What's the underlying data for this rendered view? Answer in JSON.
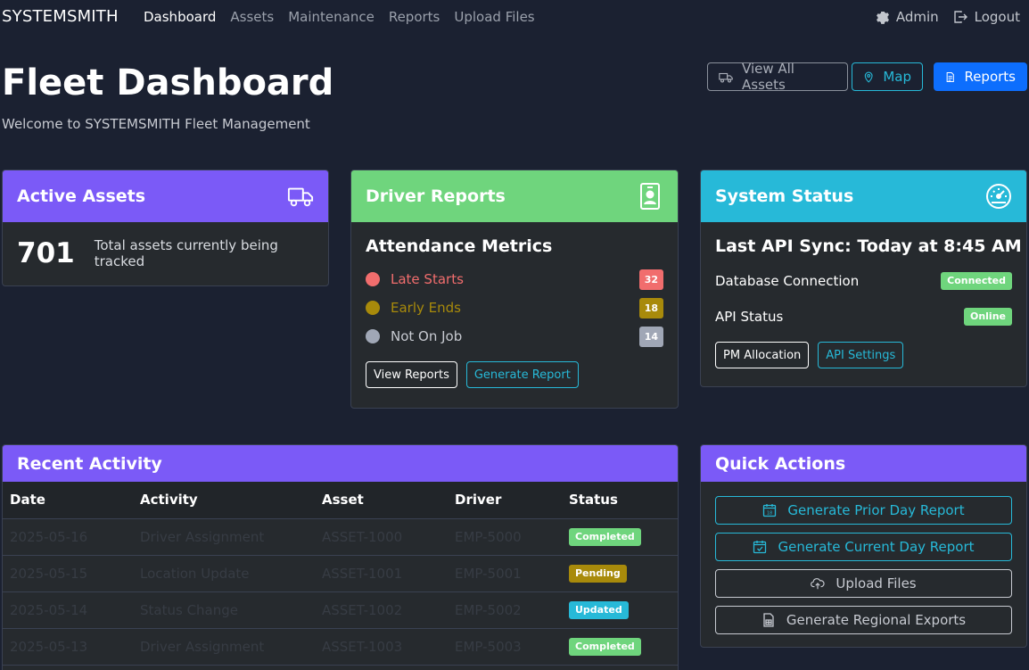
{
  "nav": {
    "brand": "SYSTEMSMITH",
    "links": [
      "Dashboard",
      "Assets",
      "Maintenance",
      "Reports",
      "Upload Files"
    ],
    "admin": "Admin",
    "logout": "Logout"
  },
  "header": {
    "title": "Fleet Dashboard",
    "subtitle": "Welcome to SYSTEMSMITH Fleet Management",
    "view_all_assets": "View All Assets",
    "map": "Map",
    "reports": "Reports"
  },
  "active_assets": {
    "title": "Active Assets",
    "count": "701",
    "description": "Total assets currently being tracked"
  },
  "driver_reports": {
    "title": "Driver Reports",
    "subtitle": "Attendance Metrics",
    "metrics": [
      {
        "label": "Late Starts",
        "count": "32",
        "color": "#f16d6d"
      },
      {
        "label": "Early Ends",
        "count": "18",
        "color": "#a88a0b"
      },
      {
        "label": "Not On Job",
        "count": "14",
        "color": "#a0a7b6"
      }
    ],
    "view_reports": "View Reports",
    "generate_report": "Generate Report"
  },
  "system_status": {
    "title": "System Status",
    "last_sync": "Last API Sync: Today at 8:45 AM",
    "db_label": "Database Connection",
    "db_status": "Connected",
    "api_label": "API Status",
    "api_status": "Online",
    "pm_allocation": "PM Allocation",
    "api_settings": "API Settings"
  },
  "recent_activity": {
    "title": "Recent Activity",
    "columns": [
      "Date",
      "Activity",
      "Asset",
      "Driver",
      "Status"
    ],
    "rows": [
      {
        "date": "2025-05-16",
        "activity": "Driver Assignment",
        "asset": "ASSET-1000",
        "driver": "EMP-5000",
        "status": "Completed",
        "status_color": "#6fd57d"
      },
      {
        "date": "2025-05-15",
        "activity": "Location Update",
        "asset": "ASSET-1001",
        "driver": "EMP-5001",
        "status": "Pending",
        "status_color": "#a88a0b"
      },
      {
        "date": "2025-05-14",
        "activity": "Status Change",
        "asset": "ASSET-1002",
        "driver": "EMP-5002",
        "status": "Updated",
        "status_color": "#27b9d8"
      },
      {
        "date": "2025-05-13",
        "activity": "Driver Assignment",
        "asset": "ASSET-1003",
        "driver": "EMP-5003",
        "status": "Completed",
        "status_color": "#6fd57d"
      }
    ]
  },
  "quick_actions": {
    "title": "Quick Actions",
    "buttons": [
      {
        "label": "Generate Prior Day Report",
        "icon": "calendar-day-icon"
      },
      {
        "label": "Generate Current Day Report",
        "icon": "calendar-check-icon"
      },
      {
        "label": "Upload Files",
        "icon": "cloud-upload-icon"
      },
      {
        "label": "Generate Regional Exports",
        "icon": "spreadsheet-icon"
      }
    ]
  },
  "colors": {
    "background": "#1b2131",
    "purple": "#7b5af7",
    "green": "#6fd57d",
    "cyan": "#27b9d8",
    "primary": "#0d6efd"
  }
}
